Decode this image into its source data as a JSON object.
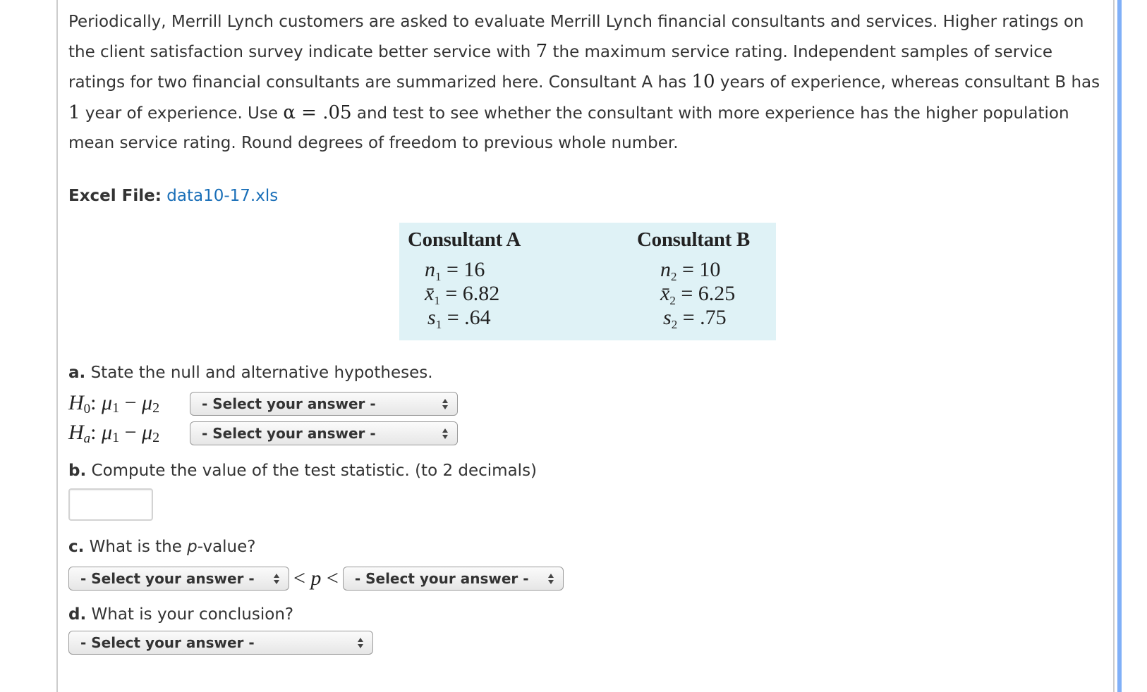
{
  "problem": {
    "segments": [
      {
        "t": "Periodically, Merrill Lynch customers are asked to evaluate Merrill Lynch financial consultants and services. Higher ratings on the client satisfaction survey indicate better service with "
      },
      {
        "m": "7"
      },
      {
        "t": " the maximum service rating. Independent samples of service ratings for two financial consultants are summarized here. Consultant A has "
      },
      {
        "m": "10"
      },
      {
        "t": " years of experience, whereas consultant B has "
      },
      {
        "m": "1"
      },
      {
        "t": " year of experience. Use "
      },
      {
        "m": "α = .05"
      },
      {
        "t": " and test to see whether the consultant with more experience has the higher population mean service rating. Round degrees of freedom to previous whole number."
      }
    ]
  },
  "excel_file": {
    "label": "Excel File:",
    "link_text": "data10-17.xls"
  },
  "summary_table": {
    "background": "#dff2f6",
    "columns": [
      {
        "header": "Consultant A",
        "rows": [
          {
            "symbol": "n",
            "sub": "1",
            "value": "16"
          },
          {
            "symbol": "x̄",
            "sub": "1",
            "value": "6.82"
          },
          {
            "symbol": "s",
            "sub": "1",
            "value": ".64"
          }
        ]
      },
      {
        "header": "Consultant B",
        "rows": [
          {
            "symbol": "n",
            "sub": "2",
            "value": "10"
          },
          {
            "symbol": "x̄",
            "sub": "2",
            "value": "6.25"
          },
          {
            "symbol": "s",
            "sub": "2",
            "value": ".75"
          }
        ]
      }
    ]
  },
  "part_a": {
    "letter": "a.",
    "prompt": " State the null and alternative hypotheses.",
    "h0": {
      "H": "H",
      "sub": "0",
      "expr_mu1": "μ",
      "n1": "1",
      "minus": " − ",
      "expr_mu2": "μ",
      "n2": "2",
      "colon": ": ",
      "select_value": "- Select your answer -"
    },
    "ha": {
      "H": "H",
      "sub": "a",
      "expr_mu1": "μ",
      "n1": "1",
      "minus": " − ",
      "expr_mu2": "μ",
      "n2": "2",
      "colon": ": ",
      "select_value": "- Select your answer -"
    }
  },
  "part_b": {
    "letter": "b.",
    "prompt": " Compute the value of the test statistic. (to 2 decimals)",
    "input_value": ""
  },
  "part_c": {
    "letter": "c.",
    "prompt_before": " What is the ",
    "prompt_italic": "p",
    "prompt_after": "-value?",
    "lower_select_value": "- Select your answer -",
    "ineq_left": "< ",
    "p": "p",
    "ineq_right": " <",
    "upper_select_value": "- Select your answer -"
  },
  "part_d": {
    "letter": "d.",
    "prompt": " What is your conclusion?",
    "select_value": "- Select your answer -"
  },
  "colors": {
    "link": "#1a6fb8",
    "scroll_accent": "#80b0f8",
    "rule": "#cccccc"
  }
}
